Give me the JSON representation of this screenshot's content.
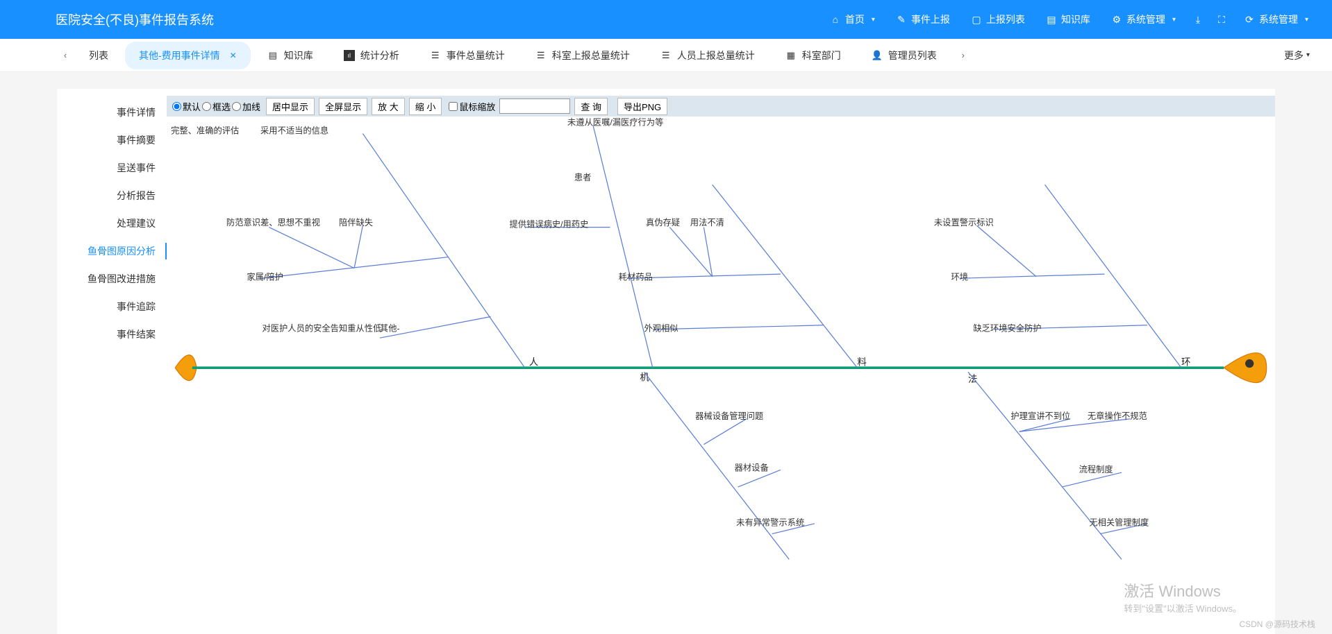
{
  "header": {
    "title": "医院安全(不良)事件报告系统",
    "nav": [
      {
        "icon": "home",
        "label": "首页",
        "caret": true
      },
      {
        "icon": "report",
        "label": "事件上报",
        "caret": false
      },
      {
        "icon": "list",
        "label": "上报列表",
        "caret": false
      },
      {
        "icon": "kb",
        "label": "知识库",
        "caret": false
      },
      {
        "icon": "gear",
        "label": "系统管理",
        "caret": true
      }
    ],
    "right_icons": [
      "download",
      "fullscreen"
    ],
    "sysmgr": "系统管理"
  },
  "tabs": {
    "items": [
      {
        "label": "列表",
        "icon": "",
        "active": false
      },
      {
        "label": "其他-费用事件详情",
        "icon": "",
        "active": true,
        "closable": true
      },
      {
        "label": "知识库",
        "icon": "book",
        "active": false
      },
      {
        "label": "统计分析",
        "icon": "stat",
        "active": false
      },
      {
        "label": "事件总量统计",
        "icon": "list",
        "active": false
      },
      {
        "label": "科室上报总量统计",
        "icon": "list",
        "active": false
      },
      {
        "label": "人员上报总量统计",
        "icon": "list",
        "active": false
      },
      {
        "label": "科室部门",
        "icon": "org",
        "active": false
      },
      {
        "label": "管理员列表",
        "icon": "user",
        "active": false
      }
    ],
    "more": "更多"
  },
  "sidenav": {
    "items": [
      "事件详情",
      "事件摘要",
      "呈送事件",
      "分析报告",
      "处理建议",
      "鱼骨图原因分析",
      "鱼骨图改进措施",
      "事件追踪",
      "事件结案"
    ],
    "active_index": 5
  },
  "toolbar": {
    "radios": [
      "默认",
      "框选",
      "加线"
    ],
    "radio_selected": 0,
    "buttons": [
      "居中显示",
      "全屏显示",
      "放 大",
      "缩 小"
    ],
    "checkbox": "鼠标缩放",
    "search_btn": "查 询",
    "export_btn": "导出PNG"
  },
  "fishbone": {
    "spine_categories": [
      "人",
      "机",
      "料",
      "法",
      "环"
    ],
    "branches": {
      "upper_left_notes": [
        "完整、准确的评估",
        "采用不适当的信息"
      ],
      "patient_line_top": [
        "未遵从医嘱/漏医疗行为等"
      ],
      "group1": {
        "root": "其他-",
        "nodes": [
          "家属/陪护",
          "防范意识差、思想不重视",
          "陪伴缺失",
          "对医护人员的安全告知重从性低"
        ]
      },
      "group2": {
        "root": "患者",
        "nodes": [
          "提供错误病史/用药史"
        ]
      },
      "group3": {
        "nodes": [
          "耗材药品",
          "真伪存疑",
          "用法不清",
          "外观相似"
        ]
      },
      "group4": {
        "nodes": [
          "环境",
          "未设置警示标识",
          "缺乏环境安全防护"
        ]
      },
      "lower_group1": {
        "nodes": [
          "器械设备管理问题",
          "器材设备",
          "未有异常警示系统"
        ]
      },
      "lower_group2": {
        "nodes": [
          "护理宣讲不到位",
          "无章操作不规范",
          "流程制度",
          "无相关管理制度"
        ]
      }
    }
  },
  "watermark": {
    "l1": "激活 Windows",
    "l2": "转到\"设置\"以激活 Windows。"
  },
  "csdn": "CSDN @源码技术栈"
}
